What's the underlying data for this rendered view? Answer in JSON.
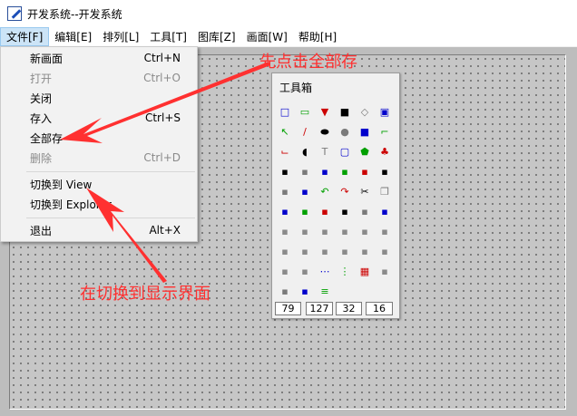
{
  "window": {
    "title": "开发系统--开发系统"
  },
  "menubar": {
    "items": [
      "文件[F]",
      "编辑[E]",
      "排列[L]",
      "工具[T]",
      "图库[Z]",
      "画面[W]",
      "帮助[H]"
    ]
  },
  "file_menu": {
    "items": [
      {
        "label": "新画面",
        "shortcut": "Ctrl+N",
        "disabled": false
      },
      {
        "label": "打开",
        "shortcut": "Ctrl+O",
        "disabled": true
      },
      {
        "label": "关闭",
        "shortcut": "",
        "disabled": false
      },
      {
        "label": "存入",
        "shortcut": "Ctrl+S",
        "disabled": false
      },
      {
        "label": "全部存",
        "shortcut": "",
        "disabled": false
      },
      {
        "label": "删除",
        "shortcut": "Ctrl+D",
        "disabled": true
      },
      {
        "label": "切换到  View",
        "shortcut": "",
        "disabled": false
      },
      {
        "label": "切换到  Explorer",
        "shortcut": "",
        "disabled": false
      },
      {
        "label": "退出",
        "shortcut": "Alt+X",
        "disabled": false
      }
    ]
  },
  "toolbox": {
    "title": "工具箱",
    "fields": [
      "79",
      "127",
      "32",
      "16"
    ],
    "rows": [
      [
        "new-page-icon",
        "open-folder-icon",
        "import-icon",
        "save-icon",
        "image-placeholder-icon",
        "green-screen-icon"
      ],
      [
        "pointer-icon",
        "line-icon",
        "ellipse-fill-icon",
        "circle-icon",
        "square-icon",
        "corner-line-icon"
      ],
      [
        "pipe-icon",
        "pie-icon",
        "text-tool-icon",
        "rounded-rect-icon",
        "polygon-icon",
        "tree-icon"
      ],
      [
        "report-icon",
        "image-frame-icon",
        "picture-icon",
        "dbc-icon",
        "curve-icon",
        "percent-icon"
      ],
      [
        "valve-icon",
        "group-icon",
        "undo-icon",
        "redo-icon",
        "cut-icon",
        "copy-icon"
      ],
      [
        "paste-icon",
        "link-icon",
        "align-icon",
        "layer-icon",
        "shape-icon",
        "flip-icon"
      ],
      [
        "color-block-icon",
        "color-block-2-icon",
        "chart-icon",
        "distribute-icon",
        "distribute-2-icon",
        "distribute-3-icon"
      ],
      [
        "align-left-icon",
        "align-center-icon",
        "align-right-icon",
        "align-top-icon",
        "align-middle-icon",
        "align-bottom-icon"
      ],
      [
        "arrange-icon",
        "arrange-2-icon",
        "dots-icon",
        "vdots-icon",
        "grid-icon",
        "palette-icon"
      ],
      [
        "colors-icon",
        "barcode-icon",
        "lines-icon"
      ]
    ],
    "icon_colors": {
      "accent_blue": "#0000cc",
      "accent_green": "#00a000",
      "accent_red": "#cc0000"
    }
  },
  "annotations": {
    "top": "先点击全部存",
    "bottom": "在切换到显示界面",
    "color": "#ff3030"
  }
}
